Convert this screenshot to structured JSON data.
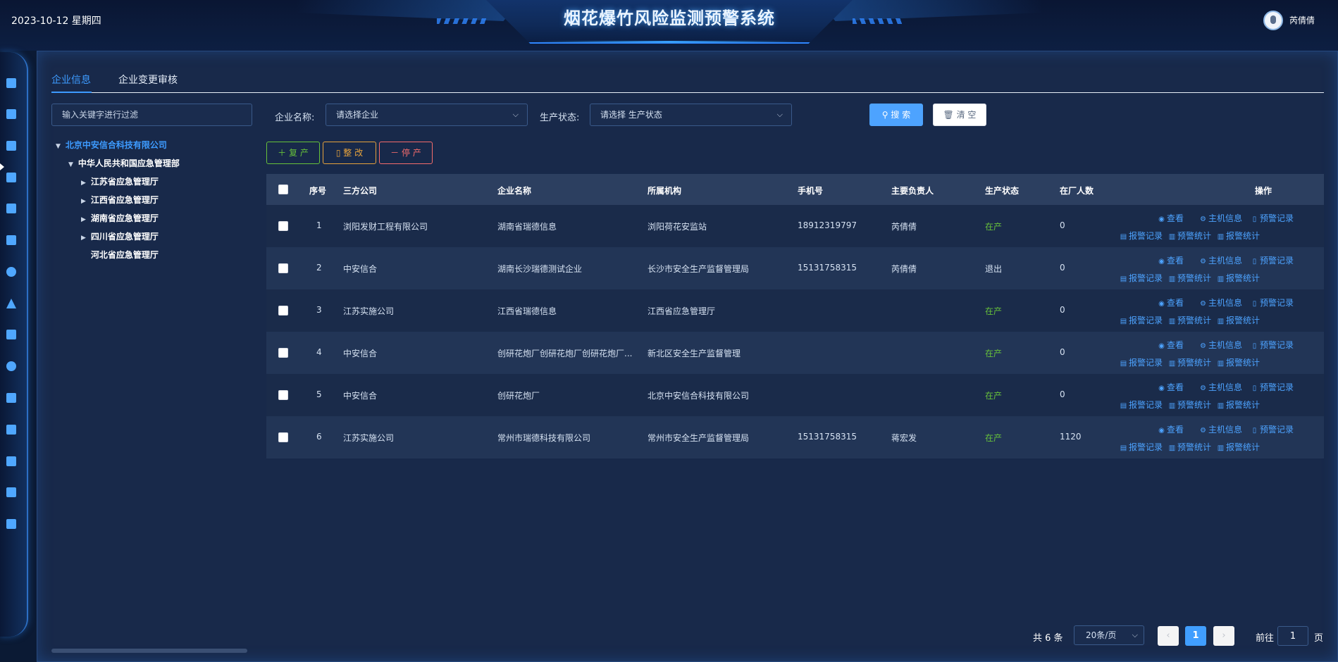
{
  "header": {
    "date": "2023-10-12 星期四",
    "title": "烟花爆竹风险监测预警系统",
    "user_name": "芮倩倩"
  },
  "side_dock": {
    "icons": [
      "home-icon",
      "building-icon",
      "briefcase-icon",
      "chart-icon",
      "id-card-icon",
      "server-icon",
      "alarm-icon",
      "warning-icon",
      "document-icon",
      "bulb-icon",
      "report-icon",
      "monitor-icon",
      "grid-icon",
      "bar-chart-icon",
      "layers-icon"
    ]
  },
  "tabs": [
    {
      "label": "企业信息",
      "active": true
    },
    {
      "label": "企业变更审核",
      "active": false
    }
  ],
  "tree": {
    "filter_placeholder": "输入关键字进行过滤",
    "nodes": [
      {
        "label": "北京中安信合科技有限公司",
        "level": 0,
        "expanded": true
      },
      {
        "label": "中华人民共和国应急管理部",
        "level": 1,
        "expanded": true
      },
      {
        "label": "江苏省应急管理厅",
        "level": 2,
        "expanded": false
      },
      {
        "label": "江西省应急管理厅",
        "level": 2,
        "expanded": false
      },
      {
        "label": "湖南省应急管理厅",
        "level": 2,
        "expanded": false
      },
      {
        "label": "四川省应急管理厅",
        "level": 2,
        "expanded": false
      },
      {
        "label": "河北省应急管理厅",
        "level": 2,
        "leaf": true
      }
    ]
  },
  "filters": {
    "enterprise_label": "企业名称:",
    "enterprise_placeholder": "请选择企业",
    "status_label": "生产状态:",
    "status_placeholder": "请选择 生产状态",
    "search_label": "搜 索",
    "clear_label": "清 空"
  },
  "actions": {
    "resume_label": "复 产",
    "rectify_label": "整 改",
    "stop_label": "停 产"
  },
  "table": {
    "columns": [
      "序号",
      "三方公司",
      "企业名称",
      "所属机构",
      "手机号",
      "主要负责人",
      "生产状态",
      "在厂人数",
      "操作"
    ],
    "rows": [
      {
        "index": "1",
        "third_party": "浏阳发财工程有限公司",
        "enterprise": "湖南省瑞德信息",
        "org": "浏阳荷花安监站",
        "phone": "18912319797",
        "manager": "芮倩倩",
        "status": "在产",
        "headcount": "0"
      },
      {
        "index": "2",
        "third_party": "中安信合",
        "enterprise": "湖南长沙瑞德测试企业",
        "org": "长沙市安全生产监督管理局",
        "phone": "15131758315",
        "manager": "芮倩倩",
        "status": "退出",
        "headcount": "0"
      },
      {
        "index": "3",
        "third_party": "江苏实施公司",
        "enterprise": "江西省瑞德信息",
        "org": "江西省应急管理厅",
        "phone": "",
        "manager": "",
        "status": "在产",
        "headcount": "0"
      },
      {
        "index": "4",
        "third_party": "中安信合",
        "enterprise": "创研花炮厂创研花炮厂创研花炮厂...",
        "org": "新北区安全生产监督管理",
        "phone": "",
        "manager": "",
        "status": "在产",
        "headcount": "0"
      },
      {
        "index": "5",
        "third_party": "中安信合",
        "enterprise": "创研花炮厂",
        "org": "北京中安信合科技有限公司",
        "phone": "",
        "manager": "",
        "status": "在产",
        "headcount": "0"
      },
      {
        "index": "6",
        "third_party": "江苏实施公司",
        "enterprise": "常州市瑞德科技有限公司",
        "org": "常州市安全生产监督管理局",
        "phone": "15131758315",
        "manager": "蒋宏发",
        "status": "在产",
        "headcount": "1120"
      }
    ],
    "row_ops": [
      "查看",
      "主机信息",
      "预警记录",
      "报警记录",
      "预警统计",
      "报警统计"
    ]
  },
  "pagination": {
    "total_text": "共 6 条",
    "page_size": "20条/页",
    "current_page": "1",
    "goto_label": "前往",
    "goto_value": "1",
    "page_suffix": "页"
  },
  "colors": {
    "accent": "#409eff",
    "status_on": "#67c23a",
    "panel_bg": "#18294a"
  }
}
